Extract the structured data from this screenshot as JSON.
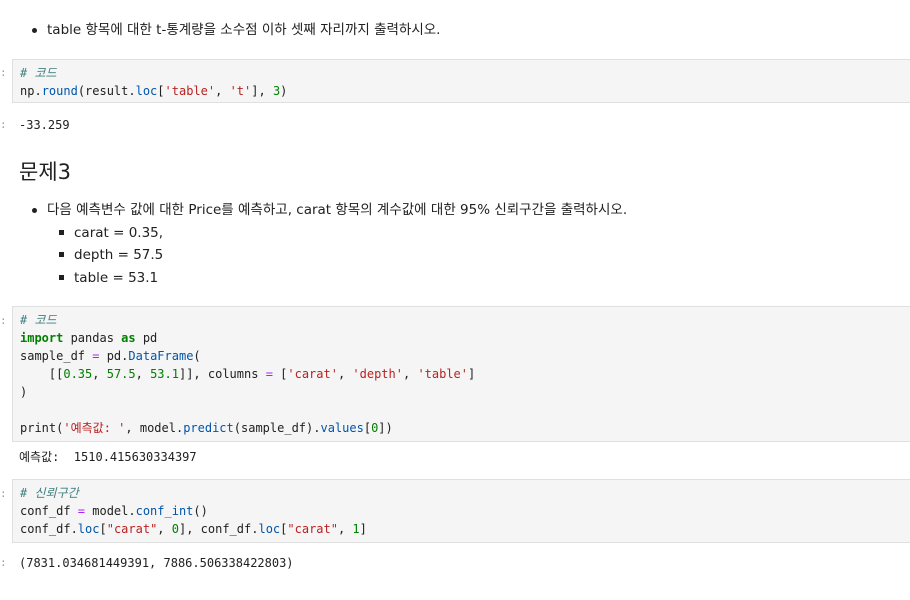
{
  "markdown1": {
    "bullet": "table 항목에 대한 t-통계량을 소수점 이하 셋째 자리까지 출력하시오."
  },
  "cell1": {
    "prompt": ":",
    "comment": "# 코드",
    "line2": {
      "a": "np.",
      "b": "round",
      "c": "(result.",
      "d": "loc",
      "e": "[",
      "f": "'table'",
      "g": ", ",
      "h": "'t'",
      "i": "], ",
      "j": "3",
      "k": ")"
    }
  },
  "output1": {
    "prompt": ":",
    "text": "-33.259"
  },
  "heading": "문제3",
  "markdown2": {
    "bullet": "다음 예측변수 값에 대한 Price를 예측하고, carat 항목의 계수값에 대한 95% 신뢰구간을 출력하시오.",
    "subbullets": [
      "carat = 0.35,",
      "depth = 57.5",
      "table = 53.1"
    ]
  },
  "cell2": {
    "prompt": ":",
    "comment": "# 코드",
    "kw_import": "import",
    "import_rest": " pandas ",
    "kw_as": "as",
    "import_alias": " pd",
    "l3a": "sample_df ",
    "l3b": "=",
    "l3c": " pd.",
    "l3d": "DataFrame",
    "l3e": "(",
    "l4a": "    [[",
    "l4b": "0.35",
    "l4c": ", ",
    "l4d": "57.5",
    "l4e": ", ",
    "l4f": "53.1",
    "l4g": "]], columns ",
    "l4h": "=",
    "l4i": " [",
    "l4j": "'carat'",
    "l4k": ", ",
    "l4l": "'depth'",
    "l4m": ", ",
    "l4n": "'table'",
    "l4o": "]",
    "l5": ")",
    "l7a": "print(",
    "l7b": "'예측값: '",
    "l7c": ", model.",
    "l7d": "predict",
    "l7e": "(sample_df).",
    "l7f": "values",
    "l7g": "[",
    "l7h": "0",
    "l7i": "])"
  },
  "output2": {
    "text": "예측값:  1510.415630334397"
  },
  "cell3": {
    "prompt": ":",
    "comment": "# 신뢰구간",
    "l2a": "conf_df ",
    "l2b": "=",
    "l2c": " model.",
    "l2d": "conf_int",
    "l2e": "()",
    "l3a": "conf_df.",
    "l3b": "loc",
    "l3c": "[",
    "l3d": "\"carat\"",
    "l3e": ", ",
    "l3f": "0",
    "l3g": "], conf_df.",
    "l3h": "loc",
    "l3i": "[",
    "l3j": "\"carat\"",
    "l3k": ", ",
    "l3l": "1",
    "l3m": "]"
  },
  "output3": {
    "prompt": ":",
    "text": "(7831.034681449391, 7886.506338422803)"
  },
  "colors": {
    "code_bg": "#f5f5f5",
    "comment": "#408080",
    "keyword": "#008000",
    "string": "#ba2121",
    "function": "#0055aa",
    "operator": "#aa22ff"
  }
}
